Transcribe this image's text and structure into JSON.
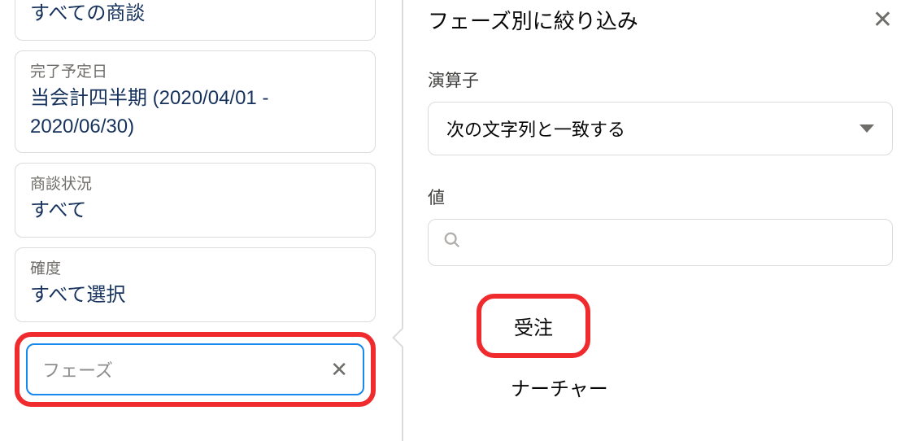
{
  "leftPanel": {
    "cards": [
      {
        "label": "",
        "value": "すべての商談",
        "truncatedTop": true
      },
      {
        "label": "完了予定日",
        "value": "当会計四半期 (2020/04/01 - 2020/06/30)"
      },
      {
        "label": "商談状況",
        "value": "すべて"
      },
      {
        "label": "確度",
        "value": "すべて選択"
      }
    ],
    "phaseField": {
      "placeholder": "フェーズ"
    }
  },
  "rightPanel": {
    "title": "フェーズ別に絞り込み",
    "operatorLabel": "演算子",
    "operatorValue": "次の文字列と一致する",
    "valueLabel": "値",
    "options": [
      {
        "label": "受注",
        "highlighted": true
      },
      {
        "label": "ナーチャー",
        "highlighted": false
      }
    ]
  }
}
